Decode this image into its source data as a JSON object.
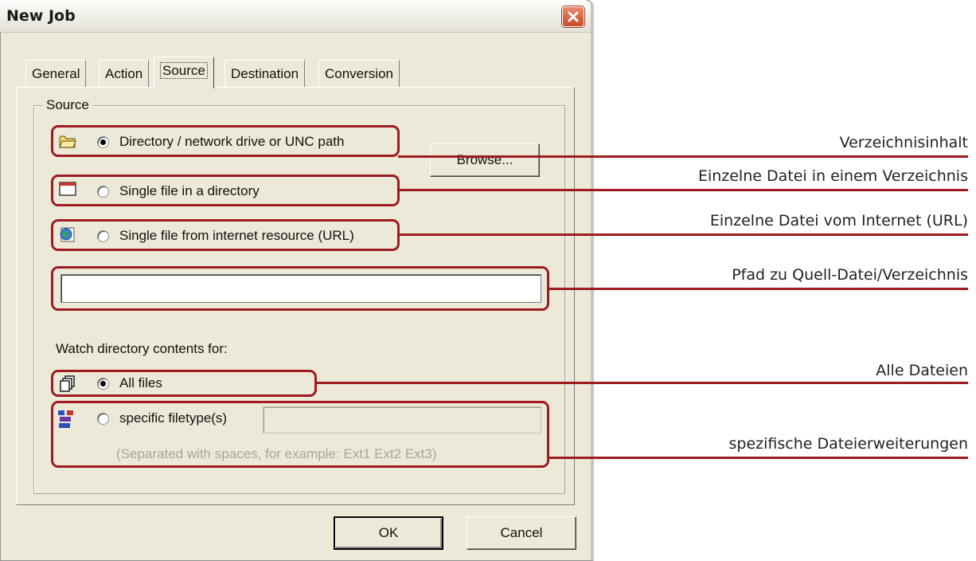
{
  "window": {
    "title": "New Job",
    "close_icon": "close-icon"
  },
  "tabs": [
    {
      "label": "General",
      "active": false
    },
    {
      "label": "Action",
      "active": false
    },
    {
      "label": "Source",
      "active": true
    },
    {
      "label": "Destination",
      "active": false
    },
    {
      "label": "Conversion",
      "active": false
    }
  ],
  "source": {
    "group_label": "Source",
    "options": [
      {
        "label": "Directory / network drive or UNC path",
        "selected": true,
        "icon": "folder-icon"
      },
      {
        "label": "Single file in a directory",
        "selected": false,
        "icon": "window-icon"
      },
      {
        "label": "Single file from internet resource (URL)",
        "selected": false,
        "icon": "globe-icon"
      }
    ],
    "browse_label": "Browse...",
    "path_value": "",
    "watch_label": "Watch directory contents for:",
    "watch_options": [
      {
        "label": "All files",
        "selected": true,
        "icon": "copy-files-icon"
      },
      {
        "label": "specific filetype(s)",
        "selected": false,
        "icon": "file-types-icon"
      }
    ],
    "filetypes_value": "",
    "hint": "(Separated with spaces, for example: Ext1 Ext2 Ext3)"
  },
  "footer": {
    "ok_label": "OK",
    "cancel_label": "Cancel"
  },
  "annotations": [
    "Verzeichnisinhalt",
    "Einzelne Datei in einem Verzeichnis",
    "Einzelne Datei vom Internet (URL)",
    "Pfad zu Quell-Datei/Verzeichnis",
    "Alle Dateien",
    "spezifische Dateierweiterungen"
  ],
  "colors": {
    "highlight": "#9e1b20",
    "dialog_bg": "#ece9d8"
  }
}
